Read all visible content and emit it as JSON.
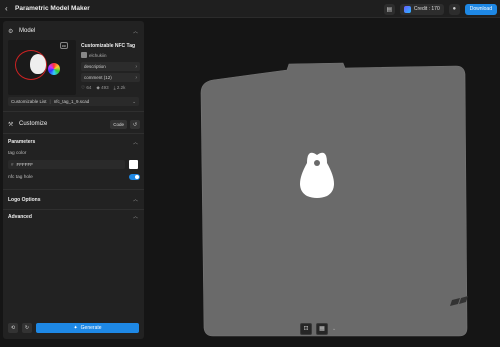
{
  "header": {
    "back_icon": "chevron-left-icon",
    "title": "Parametric Model Maker",
    "credit_label": "Credit : 170",
    "download_label": "Download"
  },
  "model": {
    "section_title": "Model",
    "name": "Customizable NFC Tag",
    "author": "elchukiin",
    "description_label": "description",
    "comments_label": "comment (12)",
    "stats": {
      "likes": "64",
      "boosts": "493",
      "downloads": "2.2k"
    },
    "file_list_label": "Customizable List",
    "file_name": "nfc_tag_1_9.scad"
  },
  "customize": {
    "section_title": "Customize",
    "code_label": "Code",
    "parameters_title": "Parameters",
    "tag_color_label": "tag color",
    "tag_color_value": "FFFFFF",
    "nfc_hole_label": "nfc tag hole",
    "nfc_hole_on": true,
    "logo_options_title": "Logo Options",
    "advanced_title": "Advanced",
    "generate_label": "Generate"
  },
  "colors": {
    "accent": "#1e88e5",
    "panel": "#222222",
    "viewport": "#151515",
    "plate": "#6b6b6b"
  }
}
